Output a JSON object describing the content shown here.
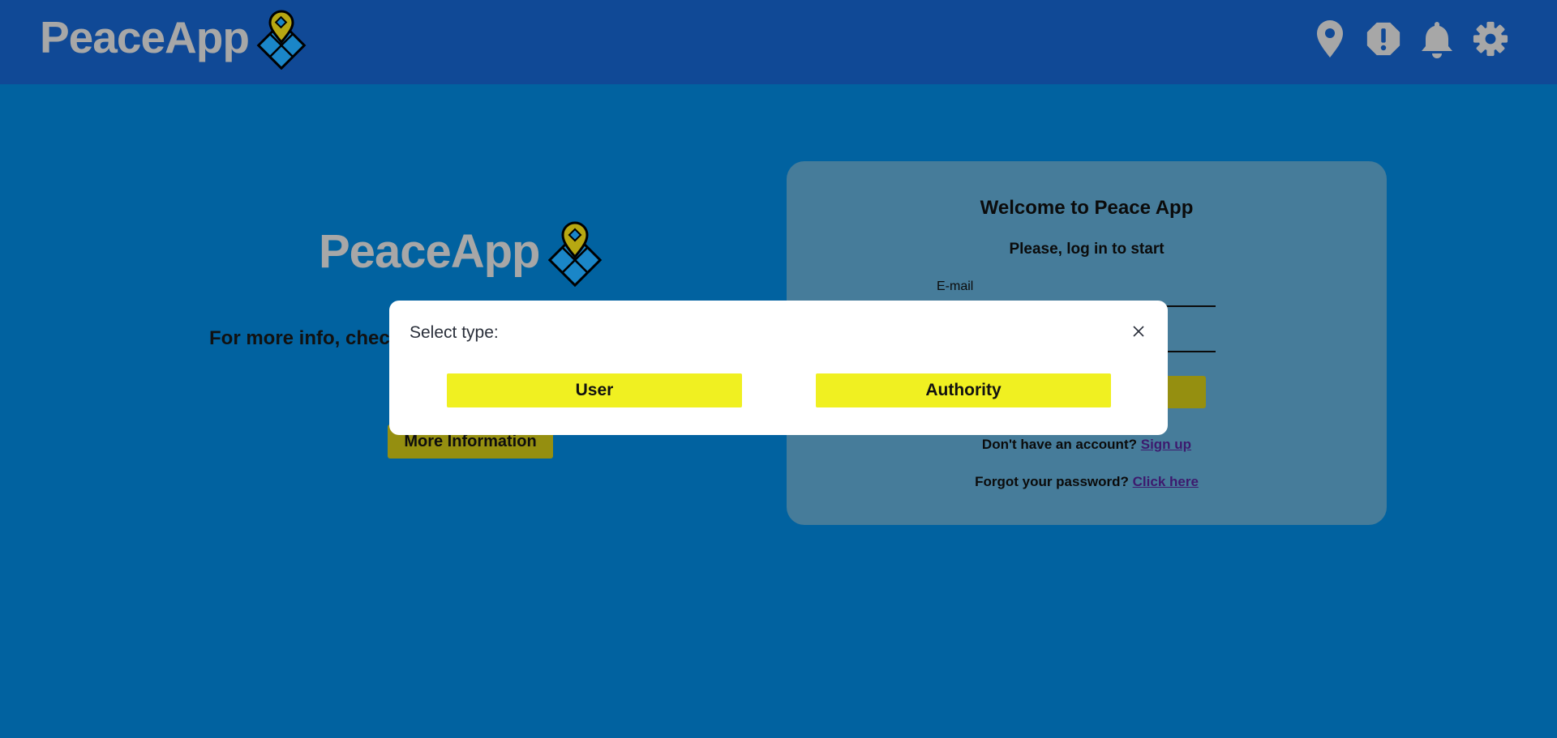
{
  "app": {
    "brand": "PeaceApp"
  },
  "header": {
    "icons": [
      "location-pin-icon",
      "alert-icon",
      "bell-icon",
      "settings-gear-icon"
    ]
  },
  "hero": {
    "brand": "PeaceApp",
    "info_text": "For more info, chec",
    "more_info_button": "More Information"
  },
  "login": {
    "title": "Welcome to Peace App",
    "subtitle": "Please, log in to start",
    "email_label": "E-mail",
    "signup_prompt": "Don't have an account?",
    "signup_link": "Sign up",
    "forgot_prompt": "Forgot your password?",
    "forgot_link": "Click here"
  },
  "modal": {
    "title": "Select type:",
    "options": [
      "User",
      "Authority"
    ]
  },
  "colors": {
    "header_bg": "#104996",
    "page_bg": "#0162a0",
    "card_bg": "#467c9a",
    "accent_yellow": "#f0f021",
    "muted_yellow": "#958f10",
    "logo_gray": "#a7a7a7"
  }
}
